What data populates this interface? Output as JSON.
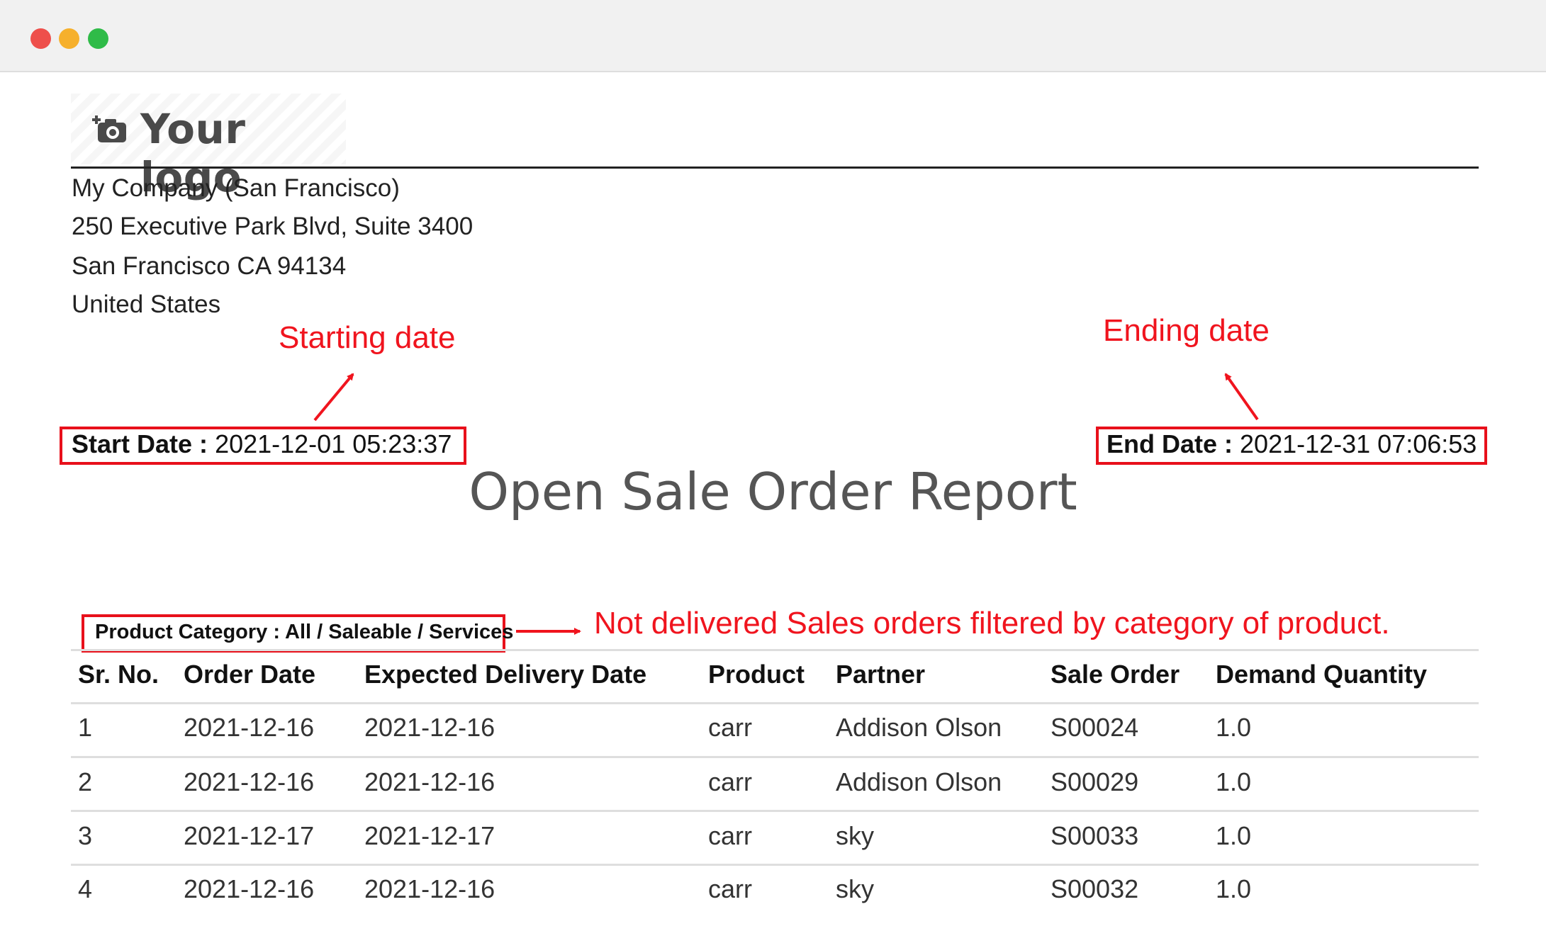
{
  "window": {
    "controls": [
      "close",
      "minimize",
      "maximize"
    ]
  },
  "logo": {
    "text": "Your logo",
    "icon": "camera-icon"
  },
  "company": {
    "name": "My Company (San Francisco)",
    "street": "250 Executive Park Blvd, Suite 3400",
    "city": "San Francisco CA 94134",
    "country": "United States"
  },
  "annotations": {
    "start": "Starting date",
    "end": "Ending date",
    "category": "Not delivered Sales orders filtered by category of product."
  },
  "dates": {
    "start_label": "Start Date :",
    "start_value": "2021-12-01 05:23:37",
    "end_label": "End Date :",
    "end_value": "2021-12-31 07:06:53"
  },
  "report": {
    "title": "Open Sale Order Report",
    "category_line": "Product Category : All / Saleable / Services"
  },
  "table": {
    "headers": [
      "Sr. No.",
      "Order Date",
      "Expected Delivery Date",
      "Product",
      "Partner",
      "Sale Order",
      "Demand Quantity"
    ],
    "rows": [
      [
        "1",
        "2021-12-16",
        "2021-12-16",
        "carr",
        "Addison Olson",
        "S00024",
        "1.0"
      ],
      [
        "2",
        "2021-12-16",
        "2021-12-16",
        "carr",
        "Addison Olson",
        "S00029",
        "1.0"
      ],
      [
        "3",
        "2021-12-17",
        "2021-12-17",
        "carr",
        "sky",
        "S00033",
        "1.0"
      ],
      [
        "4",
        "2021-12-16",
        "2021-12-16",
        "carr",
        "sky",
        "S00032",
        "1.0"
      ]
    ]
  },
  "colors": {
    "annotation": "#f0141e",
    "title": "#555555",
    "rule": "#222222"
  }
}
